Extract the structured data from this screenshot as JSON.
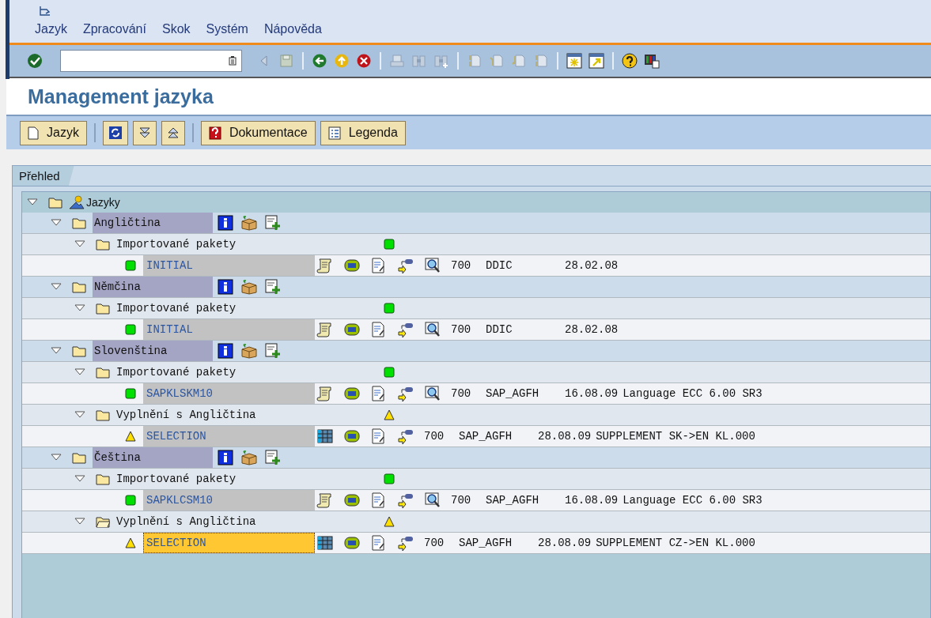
{
  "menu": [
    "Jazyk",
    "Zpracování",
    "Skok",
    "Systém",
    "Nápověda"
  ],
  "title": "Management jazyka",
  "app_toolbar": [
    "Jazyk",
    "Dokumentace",
    "Legenda"
  ],
  "tab": {
    "label": "Přehled"
  },
  "tree": {
    "label": "Jazyky",
    "expanded": true,
    "children": [
      {
        "label": "Angličtina",
        "expanded": true,
        "children": [
          {
            "label": "Importované pakety",
            "expanded": true,
            "open": false,
            "warning": false,
            "children": [
              {
                "kind": "import",
                "name": "INITIAL",
                "warning": false,
                "selected": false,
                "columns": [
                  "700",
                  "DDIC",
                  "28.02.08"
                ]
              }
            ]
          }
        ]
      },
      {
        "label": "Němčina",
        "expanded": true,
        "children": [
          {
            "label": "Importované pakety",
            "expanded": true,
            "open": false,
            "warning": false,
            "children": [
              {
                "kind": "import",
                "name": "INITIAL",
                "warning": false,
                "selected": false,
                "columns": [
                  "700",
                  "DDIC",
                  "28.02.08"
                ]
              }
            ]
          }
        ]
      },
      {
        "label": "Slovenština",
        "expanded": true,
        "children": [
          {
            "label": "Importované pakety",
            "expanded": true,
            "open": false,
            "warning": false,
            "children": [
              {
                "kind": "import",
                "name": "SAPKLSKM10",
                "warning": false,
                "selected": false,
                "columns": [
                  "700",
                  "SAP_AGFH",
                  "16.08.09",
                  "Language ECC 6.00 SR3"
                ]
              }
            ]
          },
          {
            "label": "Vyplnění s Angličtina",
            "expanded": true,
            "open": false,
            "warning": true,
            "children": [
              {
                "kind": "selection",
                "name": "SELECTION",
                "warning": true,
                "selected": false,
                "columns": [
                  "700",
                  "SAP_AGFH",
                  "28.08.09",
                  "SUPPLEMENT SK->EN KL.000"
                ]
              }
            ]
          }
        ]
      },
      {
        "label": "Čeština",
        "expanded": true,
        "children": [
          {
            "label": "Importované pakety",
            "expanded": true,
            "open": false,
            "warning": false,
            "children": [
              {
                "kind": "import",
                "name": "SAPKLCSM10",
                "warning": false,
                "selected": false,
                "columns": [
                  "700",
                  "SAP_AGFH",
                  "16.08.09",
                  "Language ECC 6.00 SR3"
                ]
              }
            ]
          },
          {
            "label": "Vyplnění s Angličtina",
            "expanded": true,
            "open": true,
            "warning": true,
            "children": [
              {
                "kind": "selection",
                "name": "SELECTION",
                "warning": true,
                "selected": true,
                "columns": [
                  "700",
                  "SAP_AGFH",
                  "28.08.09",
                  "SUPPLEMENT CZ->EN KL.000"
                ]
              }
            ]
          }
        ]
      }
    ]
  }
}
